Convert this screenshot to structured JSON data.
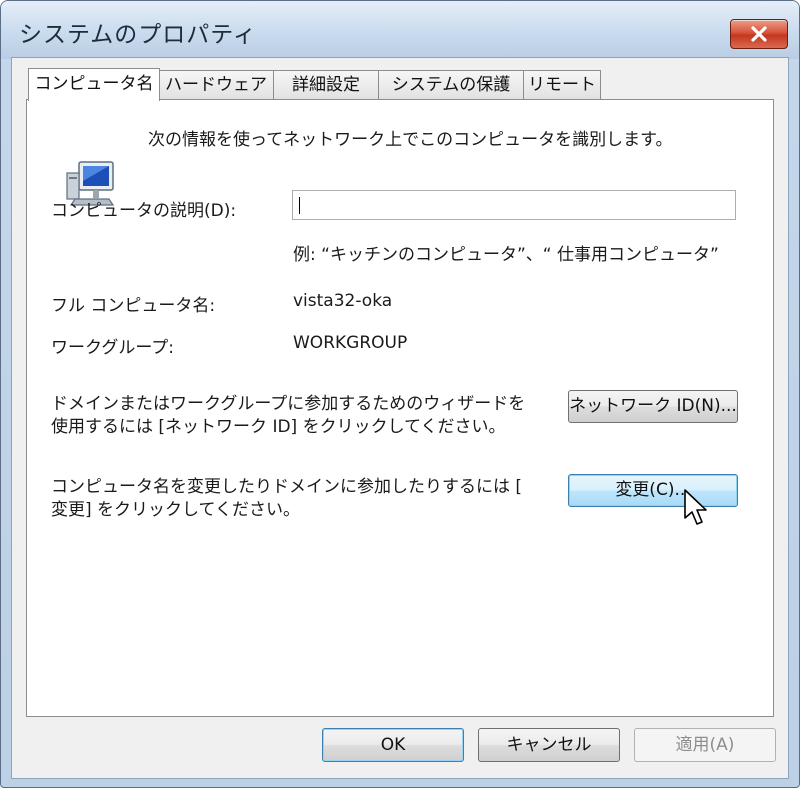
{
  "window": {
    "title": "システムのプロパティ"
  },
  "tabs": [
    {
      "label": "コンピュータ名",
      "active": true
    },
    {
      "label": "ハードウェア",
      "active": false
    },
    {
      "label": "詳細設定",
      "active": false
    },
    {
      "label": "システムの保護",
      "active": false
    },
    {
      "label": "リモート",
      "active": false
    }
  ],
  "panel": {
    "intro_text": "次の情報を使ってネットワーク上でこのコンピュータを識別します。",
    "description_label": "コンピュータの説明(D):",
    "description_value": "",
    "description_example": "例: “キッチンのコンピュータ”、“ 仕事用コンピュータ”",
    "full_name_label": "フル コンピュータ名:",
    "full_name_value": "vista32-oka",
    "workgroup_label": "ワークグループ:",
    "workgroup_value": "WORKGROUP",
    "network_id_text_line1": "ドメインまたはワークグループに参加するためのウィザードを",
    "network_id_text_line2": "使用するには [ネットワーク ID] をクリックしてください。",
    "network_id_button": "ネットワーク ID(N)...",
    "change_text_line1": "コンピュータ名を変更したりドメインに参加したりするには [",
    "change_text_line2": "変更] をクリックしてください。",
    "change_button": "変更(C)..."
  },
  "footer": {
    "ok_button": "OK",
    "cancel_button": "キャンセル",
    "apply_button": "適用(A)"
  },
  "icons": {
    "computer": "computer-icon",
    "close": "close-icon",
    "cursor": "mouse-pointer-icon"
  }
}
